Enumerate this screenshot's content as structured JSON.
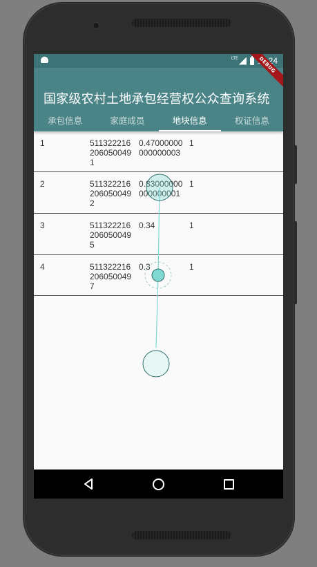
{
  "app": {
    "title": "国家级农村土地承包经营权公众查询系统"
  },
  "status_bar": {
    "time": "11:24",
    "network": "LTE",
    "icons": [
      "android-icon",
      "signal-icon",
      "battery-icon"
    ]
  },
  "debug_banner": "DEBUG",
  "tabs": [
    {
      "label": "承包信息",
      "active": false
    },
    {
      "label": "家庭成员",
      "active": false
    },
    {
      "label": "地块信息",
      "active": true
    },
    {
      "label": "权证信息",
      "active": false
    }
  ],
  "rows": [
    {
      "index": "1",
      "code": "5113222162060500491",
      "area": "0.47000000000000003",
      "count": "1"
    },
    {
      "index": "2",
      "code": "5113222162060500492",
      "area": "0.83000000000000001",
      "count": "1"
    },
    {
      "index": "3",
      "code": "5113222162060500495",
      "area": "0.34",
      "count": "1"
    },
    {
      "index": "4",
      "code": "5113222162060500497",
      "area": "0.3",
      "count": "1"
    }
  ],
  "nav_bar": {
    "icons": [
      "back-icon",
      "home-icon",
      "recents-icon"
    ]
  },
  "colors": {
    "status_bar": "#3d7478",
    "app_bar": "#4a8487",
    "touch_indicator": "#7fd8d2",
    "divider": "#444444"
  }
}
